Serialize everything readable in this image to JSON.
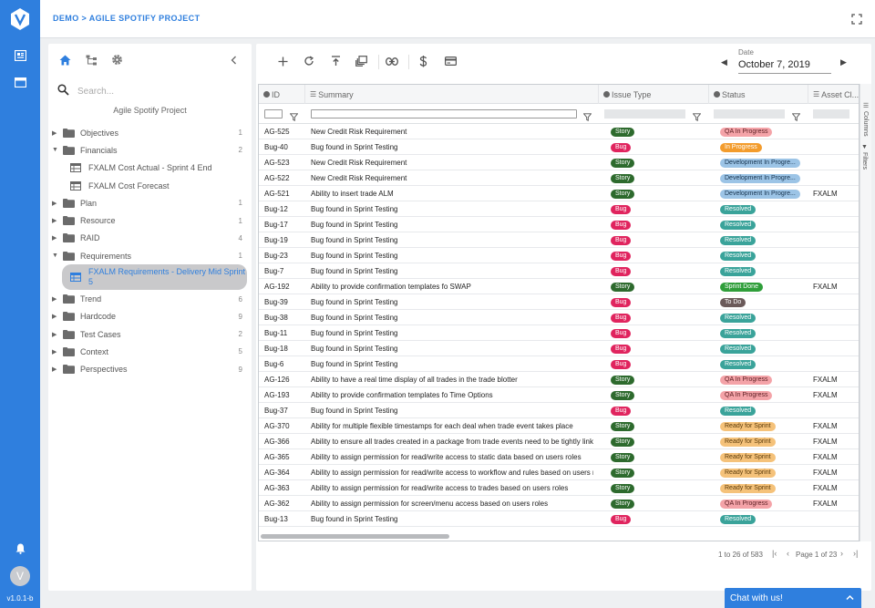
{
  "app": {
    "version": "v1.0.1-b",
    "avatar_initial": "V",
    "brand_color": "#2f7fde"
  },
  "topbar": {
    "breadcrumb": "DEMO > AGILE SPOTIFY PROJECT"
  },
  "sidebar": {
    "search_placeholder": "Search...",
    "project_title": "Agile Spotify Project",
    "items": [
      {
        "label": "Objectives",
        "count": "1",
        "expanded": false
      },
      {
        "label": "Financials",
        "count": "2",
        "expanded": true
      },
      {
        "label": "FXALM Cost Actual - Sprint 4 End",
        "child": true
      },
      {
        "label": "FXALM Cost Forecast",
        "child": true
      },
      {
        "label": "Plan",
        "count": "1",
        "expanded": false
      },
      {
        "label": "Resource",
        "count": "1",
        "expanded": false
      },
      {
        "label": "RAID",
        "count": "4",
        "expanded": false
      },
      {
        "label": "Requirements",
        "count": "1",
        "expanded": true
      },
      {
        "label": "FXALM Requirements - Delivery Mid Sprint 5",
        "child": true,
        "selected": true
      },
      {
        "label": "Trend",
        "count": "6",
        "expanded": false
      },
      {
        "label": "Hardcode",
        "count": "9",
        "expanded": false
      },
      {
        "label": "Test Cases",
        "count": "2",
        "expanded": false
      },
      {
        "label": "Context",
        "count": "5",
        "expanded": false
      },
      {
        "label": "Perspectives",
        "count": "9",
        "expanded": false
      }
    ]
  },
  "main": {
    "date_label": "Date",
    "date_value": "October 7, 2019",
    "columns": [
      "ID",
      "Summary",
      "Issue Type",
      "Status",
      "Asset Cl..."
    ],
    "side_tabs": [
      "Columns",
      "Filters"
    ],
    "pager": {
      "range": "1 to 26 of 583",
      "page": "Page 1 of 23"
    },
    "status_colors": {
      "Story": "#2d6a2d",
      "Bug": "#e0245e",
      "QA In Progress": "#f4a3a8",
      "In Progress": "#f39c2d",
      "Development In Progre...": "#9cc4e6",
      "Resolved": "#3aa39a",
      "Sprint Done": "#2f9e3a",
      "To Do": "#6b5a5a",
      "Ready for Sprint": "#f5c27a"
    },
    "rows": [
      {
        "id": "AG-525",
        "summary": "New Credit Risk Requirement",
        "type": "Story",
        "status": "QA In Progress",
        "asset": ""
      },
      {
        "id": "Bug-40",
        "summary": "Bug found in Sprint Testing",
        "type": "Bug",
        "status": "In Progress",
        "asset": ""
      },
      {
        "id": "AG-523",
        "summary": "New Credit Risk Requirement",
        "type": "Story",
        "status": "Development In Progre...",
        "asset": ""
      },
      {
        "id": "AG-522",
        "summary": "New Credit Risk Requirement",
        "type": "Story",
        "status": "Development In Progre...",
        "asset": ""
      },
      {
        "id": "AG-521",
        "summary": "Ability to insert trade ALM",
        "type": "Story",
        "status": "Development In Progre...",
        "asset": "FXALM"
      },
      {
        "id": "Bug-12",
        "summary": "Bug found in Sprint Testing",
        "type": "Bug",
        "status": "Resolved",
        "asset": ""
      },
      {
        "id": "Bug-17",
        "summary": "Bug found in Sprint Testing",
        "type": "Bug",
        "status": "Resolved",
        "asset": ""
      },
      {
        "id": "Bug-19",
        "summary": "Bug found in Sprint Testing",
        "type": "Bug",
        "status": "Resolved",
        "asset": ""
      },
      {
        "id": "Bug-23",
        "summary": "Bug found in Sprint Testing",
        "type": "Bug",
        "status": "Resolved",
        "asset": ""
      },
      {
        "id": "Bug-7",
        "summary": "Bug found in Sprint Testing",
        "type": "Bug",
        "status": "Resolved",
        "asset": ""
      },
      {
        "id": "AG-192",
        "summary": "Ability to provide confirmation templates fo SWAP",
        "type": "Story",
        "status": "Sprint Done",
        "asset": "FXALM"
      },
      {
        "id": "Bug-39",
        "summary": "Bug found in Sprint Testing",
        "type": "Bug",
        "status": "To Do",
        "asset": ""
      },
      {
        "id": "Bug-38",
        "summary": "Bug found in Sprint Testing",
        "type": "Bug",
        "status": "Resolved",
        "asset": ""
      },
      {
        "id": "Bug-11",
        "summary": "Bug found in Sprint Testing",
        "type": "Bug",
        "status": "Resolved",
        "asset": ""
      },
      {
        "id": "Bug-18",
        "summary": "Bug found in Sprint Testing",
        "type": "Bug",
        "status": "Resolved",
        "asset": ""
      },
      {
        "id": "Bug-6",
        "summary": "Bug found in Sprint Testing",
        "type": "Bug",
        "status": "Resolved",
        "asset": ""
      },
      {
        "id": "AG-126",
        "summary": "Ability to have a real time display of all trades in the trade blotter",
        "type": "Story",
        "status": "QA In Progress",
        "asset": "FXALM"
      },
      {
        "id": "AG-193",
        "summary": "Ability to provide confirmation templates fo Time Options",
        "type": "Story",
        "status": "QA In Progress",
        "asset": "FXALM"
      },
      {
        "id": "Bug-37",
        "summary": "Bug found in Sprint Testing",
        "type": "Bug",
        "status": "Resolved",
        "asset": ""
      },
      {
        "id": "AG-370",
        "summary": "Ability for multiple flexible timestamps for each deal when trade event takes place",
        "type": "Story",
        "status": "Ready for Sprint",
        "asset": "FXALM"
      },
      {
        "id": "AG-366",
        "summary": "Ability to ensure all trades created in a package from trade events need to be tightly linked. ...",
        "type": "Story",
        "status": "Ready for Sprint",
        "asset": "FXALM"
      },
      {
        "id": "AG-365",
        "summary": "Ability to assign permission for read/write access to static data based on users roles",
        "type": "Story",
        "status": "Ready for Sprint",
        "asset": "FXALM"
      },
      {
        "id": "AG-364",
        "summary": "Ability to assign permission for read/write access to workflow and rules based on users roles",
        "type": "Story",
        "status": "Ready for Sprint",
        "asset": "FXALM"
      },
      {
        "id": "AG-363",
        "summary": "Ability to assign permission for read/write access to trades based on users roles",
        "type": "Story",
        "status": "Ready for Sprint",
        "asset": "FXALM"
      },
      {
        "id": "AG-362",
        "summary": "Ability to assign permission for screen/menu access based on users roles",
        "type": "Story",
        "status": "QA In Progress",
        "asset": "FXALM"
      },
      {
        "id": "Bug-13",
        "summary": "Bug found in Sprint Testing",
        "type": "Bug",
        "status": "Resolved",
        "asset": ""
      }
    ]
  },
  "chat": {
    "label": "Chat with us!"
  }
}
